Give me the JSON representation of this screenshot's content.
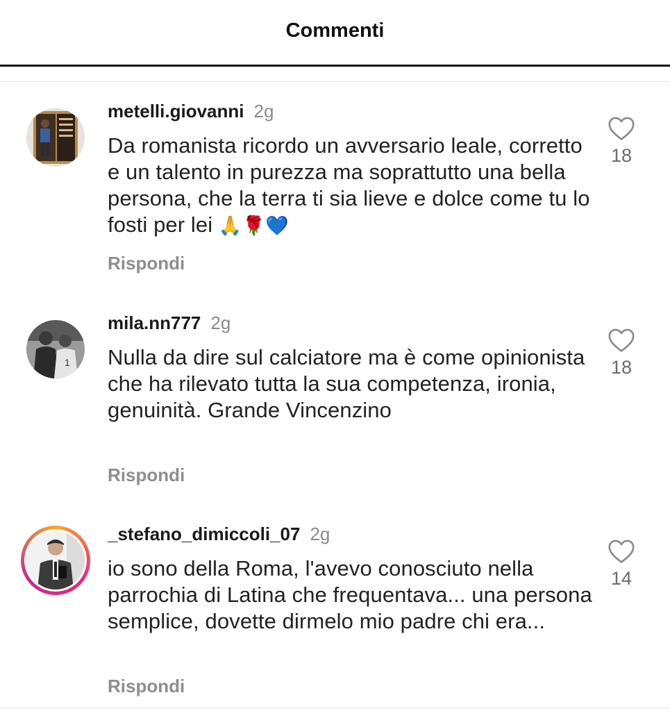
{
  "header": {
    "title": "Commenti"
  },
  "comments": [
    {
      "username": "metelli.giovanni",
      "time": "2g",
      "text": "Da romanista ricordo un avversario leale, corretto e un talento in purezza ma soprattutto una bella persona, che la terra ti sia lieve e dolce come tu lo fosti per lei",
      "emojis": "🙏🌹💙",
      "reply_label": "Rispondi",
      "likes": "18",
      "avatar": "poster-photo",
      "story_ring": false
    },
    {
      "username": "mila.nn777",
      "time": "2g",
      "text": "Nulla da dire sul calciatore ma è come opinionista che ha rilevato tutta la sua competenza, ironia, genuinità. Grande Vincenzino",
      "reply_label": "Rispondi",
      "likes": "18",
      "avatar": "bw-football-photo",
      "story_ring": false
    },
    {
      "username": "_stefano_dimiccoli_07",
      "time": "2g",
      "text": "io sono della Roma, l'avevo conosciuto nella parrochia di Latina che frequentava... una persona semplice, dovette dirmelo mio padre chi era...",
      "reply_label": "Rispondi",
      "likes": "14",
      "avatar": "mirror-selfie-photo",
      "story_ring": true
    }
  ],
  "icons": {
    "like": "heart-outline-icon"
  },
  "colors": {
    "secondary_text": "#8e8e8e",
    "story_ring": [
      "#f9a826",
      "#ee2a7b",
      "#c02e8f"
    ]
  }
}
